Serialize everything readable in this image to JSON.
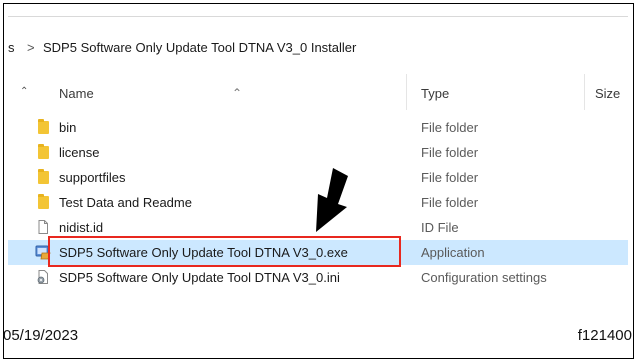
{
  "breadcrumb": {
    "prev_fragment": "s",
    "separator": ">",
    "current": "SDP5 Software Only Update Tool DTNA V3_0 Installer"
  },
  "columns": {
    "name": "Name",
    "type": "Type",
    "size": "Size"
  },
  "files": [
    {
      "name": "bin",
      "type": "File folder",
      "icon": "folder-icon"
    },
    {
      "name": "license",
      "type": "File folder",
      "icon": "folder-icon"
    },
    {
      "name": "supportfiles",
      "type": "File folder",
      "icon": "folder-icon"
    },
    {
      "name": "Test Data and Readme",
      "type": "File folder",
      "icon": "folder-icon"
    },
    {
      "name": "nidist.id",
      "type": "ID File",
      "icon": "file-icon"
    },
    {
      "name": "SDP5 Software Only Update Tool DTNA V3_0.exe",
      "type": "Application",
      "icon": "application-icon",
      "selected": true
    },
    {
      "name": "SDP5 Software Only Update Tool DTNA V3_0.ini",
      "type": "Configuration settings",
      "icon": "config-file-icon"
    }
  ],
  "footer": {
    "date": "05/19/2023",
    "figure_id": "f121400"
  },
  "colors": {
    "selection": "#cce8ff",
    "highlight_box": "#e8281f",
    "folder": "#f3c535"
  }
}
